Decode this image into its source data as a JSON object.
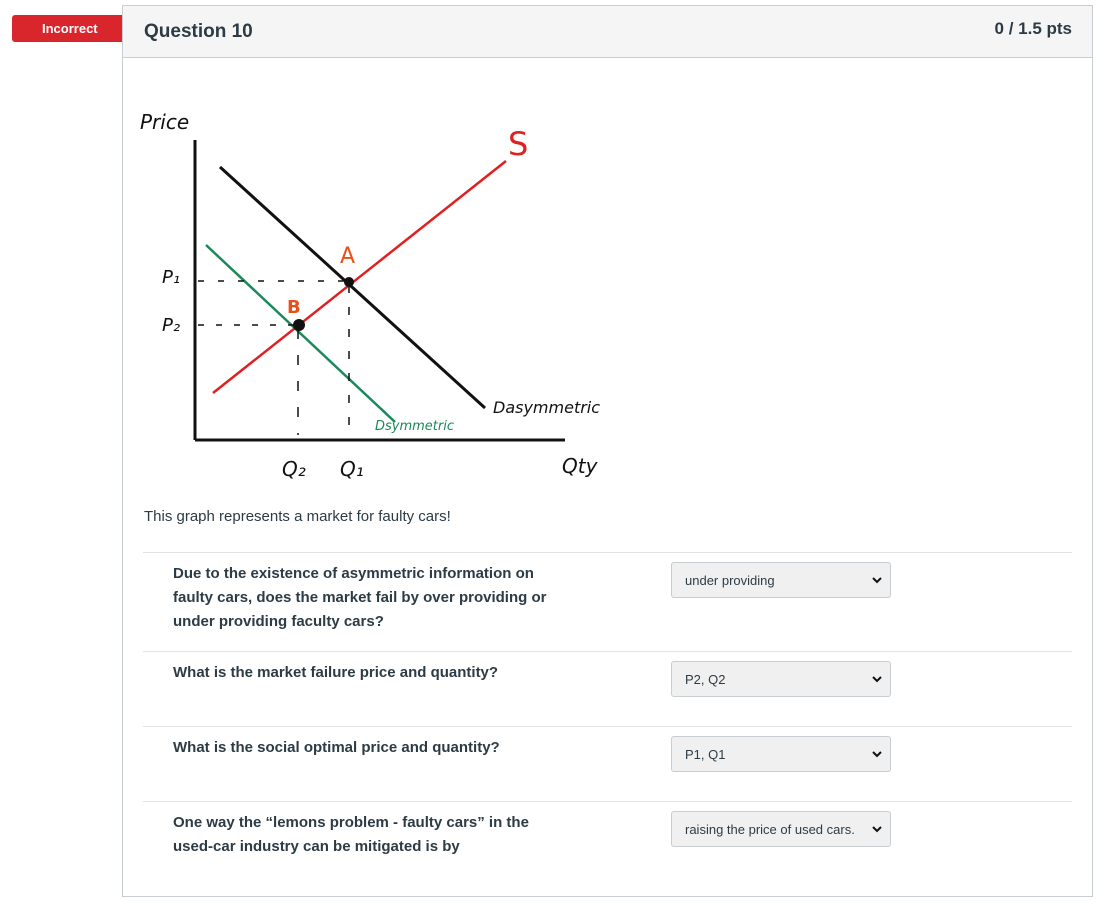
{
  "status": {
    "label": "Incorrect",
    "color": "#d9262c"
  },
  "question": {
    "title": "Question 10",
    "points": "0 / 1.5 pts"
  },
  "graph": {
    "price_label": "Price",
    "qty_label": "Qty",
    "p1_label": "P₁",
    "p2_label": "P₂",
    "q1_label": "Q₁",
    "q2_label": "Q₂",
    "supply_label": "S",
    "point_a_label": "A",
    "point_b_label": "B",
    "d_asymmetric_label": "Dasymmetric",
    "d_symmetric_label": "Dsymmetric",
    "colors": {
      "supply": "#e02020",
      "d_asymmetric": "#111111",
      "d_symmetric": "#1a8a5a",
      "point_labels": "#e8501a"
    }
  },
  "caption": "This graph represents a market for faulty cars!",
  "questions": [
    {
      "text": "Due to the existence of asymmetric information on faulty cars, does the market fail by over providing or under providing faculty cars?",
      "answer": "under providing"
    },
    {
      "text": "What is the market failure price and quantity?",
      "answer": "P2, Q2"
    },
    {
      "text": "What is the social optimal price and quantity?",
      "answer": "P1, Q1"
    },
    {
      "text": "One way the “lemons problem - faulty cars” in the used-car industry can be mitigated is by",
      "answer": "raising the price of used cars."
    }
  ]
}
